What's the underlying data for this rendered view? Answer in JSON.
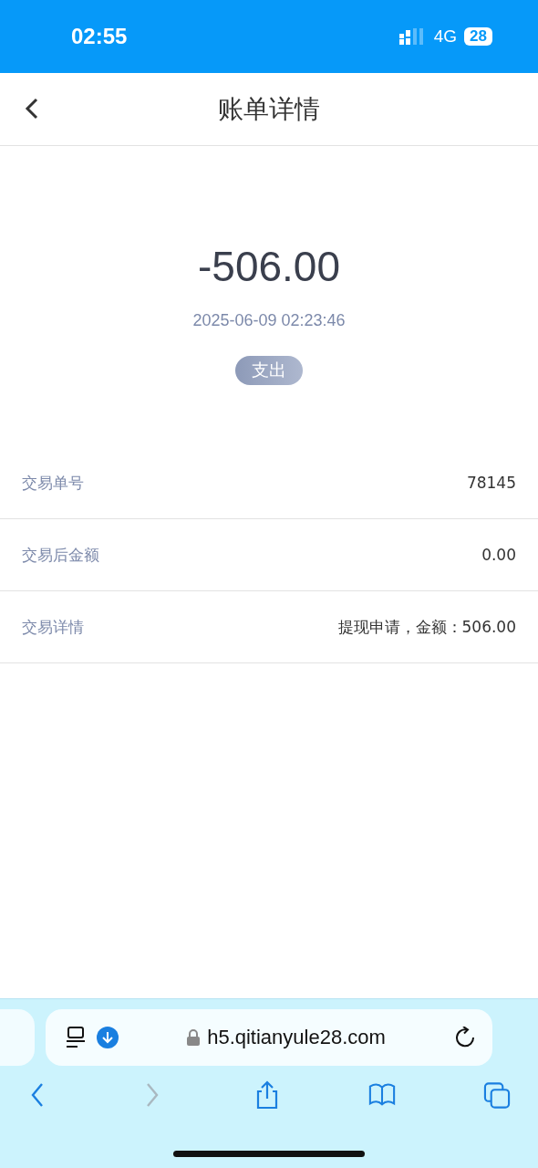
{
  "status_bar": {
    "time": "02:55",
    "network": "4G",
    "battery": "28"
  },
  "nav": {
    "title": "账单详情"
  },
  "summary": {
    "amount": "-506.00",
    "datetime": "2025-06-09 02:23:46",
    "tag": "支出"
  },
  "details": [
    {
      "label": "交易单号",
      "value": "78145"
    },
    {
      "label": "交易后金额",
      "value": "0.00"
    },
    {
      "label": "交易详情",
      "value": "提现申请，金额：506.00"
    }
  ],
  "browser": {
    "url": "h5.qitianyule28.com",
    "toolbar": [
      {
        "kind": "back",
        "disabled": false
      },
      {
        "kind": "forward",
        "disabled": true
      },
      {
        "kind": "share",
        "disabled": false
      },
      {
        "kind": "bookmarks",
        "disabled": false
      },
      {
        "kind": "tabs",
        "disabled": false
      }
    ]
  }
}
